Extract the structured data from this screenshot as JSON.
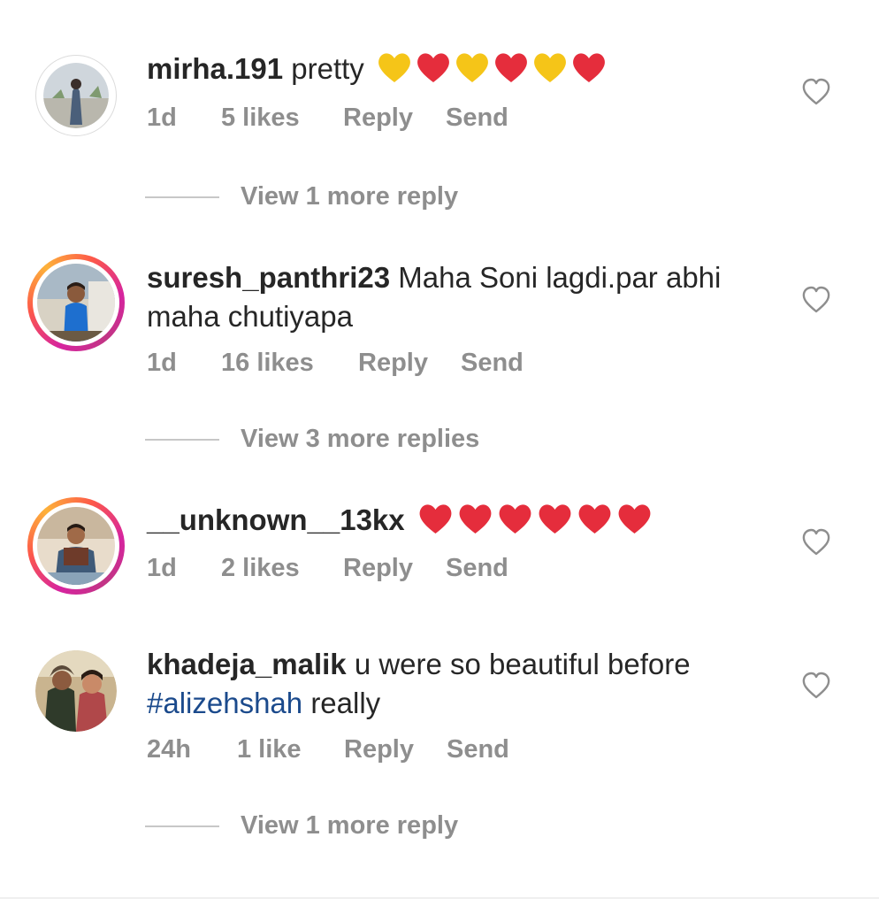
{
  "colors": {
    "text": "#262626",
    "muted": "#8e8e8e",
    "hashtag": "#1b4a8c",
    "heart_red": "#e52d3c",
    "heart_yellow": "#f5c518"
  },
  "comments": [
    {
      "username": "mirha.191",
      "text": "pretty",
      "emojis": [
        "yellow-heart",
        "red-heart",
        "yellow-heart",
        "red-heart",
        "yellow-heart",
        "red-heart"
      ],
      "time": "1d",
      "likes": "5 likes",
      "reply": "Reply",
      "send": "Send",
      "view_replies": "View 1 more reply"
    },
    {
      "username": "suresh_panthri23",
      "text": "Maha Soni lagdi.par abhi maha chutiyapa",
      "time": "1d",
      "likes": "16 likes",
      "reply": "Reply",
      "send": "Send",
      "view_replies": "View 3 more replies"
    },
    {
      "username": "__unknown__13kx",
      "text": "",
      "emojis": [
        "red-heart",
        "red-heart",
        "red-heart",
        "red-heart",
        "red-heart",
        "red-heart"
      ],
      "time": "1d",
      "likes": "2 likes",
      "reply": "Reply",
      "send": "Send"
    },
    {
      "username": "khadeja_malik",
      "text": "u were so beautiful before",
      "hashtag": "#alizehshah",
      "text_after": "really",
      "time": "24h",
      "likes": "1 like",
      "reply": "Reply",
      "send": "Send",
      "view_replies": "View 1 more reply"
    }
  ]
}
